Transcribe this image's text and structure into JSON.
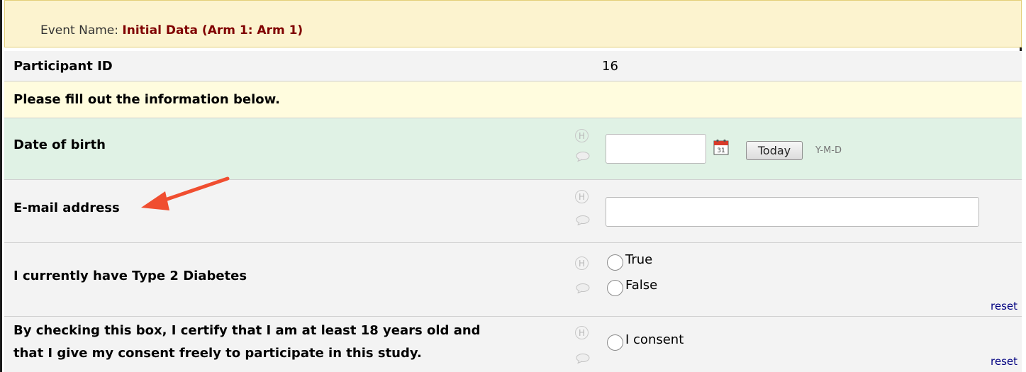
{
  "event": {
    "prefix": "Event Name:",
    "name": "Initial Data (Arm 1: Arm 1)"
  },
  "participant": {
    "label": "Participant ID",
    "value": "16"
  },
  "instructions": "Please fill out the information below.",
  "fields": {
    "dob": {
      "label": "Date of birth",
      "value": "",
      "today_label": "Today",
      "format_hint": "Y-M-D",
      "calendar_day": "31"
    },
    "email": {
      "label": "E-mail address",
      "value": ""
    },
    "diabetes": {
      "label": "I currently have Type 2 Diabetes",
      "options": [
        "True",
        "False"
      ],
      "reset_label": "reset"
    },
    "consent": {
      "label_line1": "By checking this box, I certify that I am at least 18 years old and",
      "label_line2": "that I give my consent freely to participate in this study.",
      "option": "I consent",
      "reset_label": "reset"
    }
  },
  "icons": {
    "history": "H",
    "comment": "comment-bubble-icon"
  },
  "colors": {
    "arrow": "#f04e30",
    "event_name": "#800000",
    "reset_link": "#000080"
  }
}
